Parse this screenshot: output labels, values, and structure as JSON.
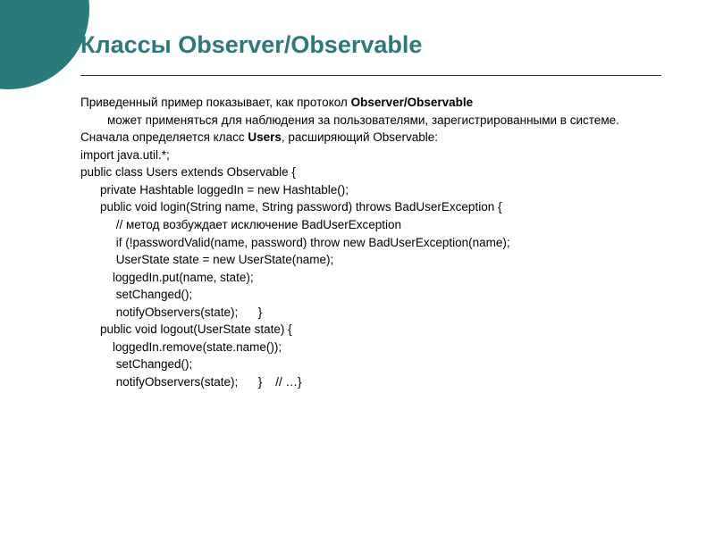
{
  "title": "Классы Observer/Observable",
  "intro": {
    "part1": "Приведенный пример показывает, как протокол ",
    "bold1": "Observer/Observable",
    "part2": " может применяться для наблюдения за пользователями, зарегистрированными в системе."
  },
  "line2": {
    "part1": "Сначала определяется класс ",
    "bold1": "Users",
    "part2": ", расширяющий Observable:"
  },
  "code": {
    "l1": "import java.util.*;",
    "l2": "public class Users extends Observable {",
    "l3": "private Hashtable loggedIn = new Hashtable();",
    "l4": "public void login(String name, String password) throws BadUserException {",
    "l5": " // метод возбуждает исключение BadUserException",
    "l6": " if (!passwordValid(name, password) throw new BadUserException(name);",
    "l7": " UserState state = new UserState(name);",
    "l8": "loggedIn.put(name, state);",
    "l9": " setChanged();",
    "l10": " notifyObservers(state);      }",
    "l11": "public void logout(UserState state) {",
    "l12": "loggedIn.remove(state.name());",
    "l13": " setChanged();",
    "l14": " notifyObservers(state);      }    // …}"
  }
}
